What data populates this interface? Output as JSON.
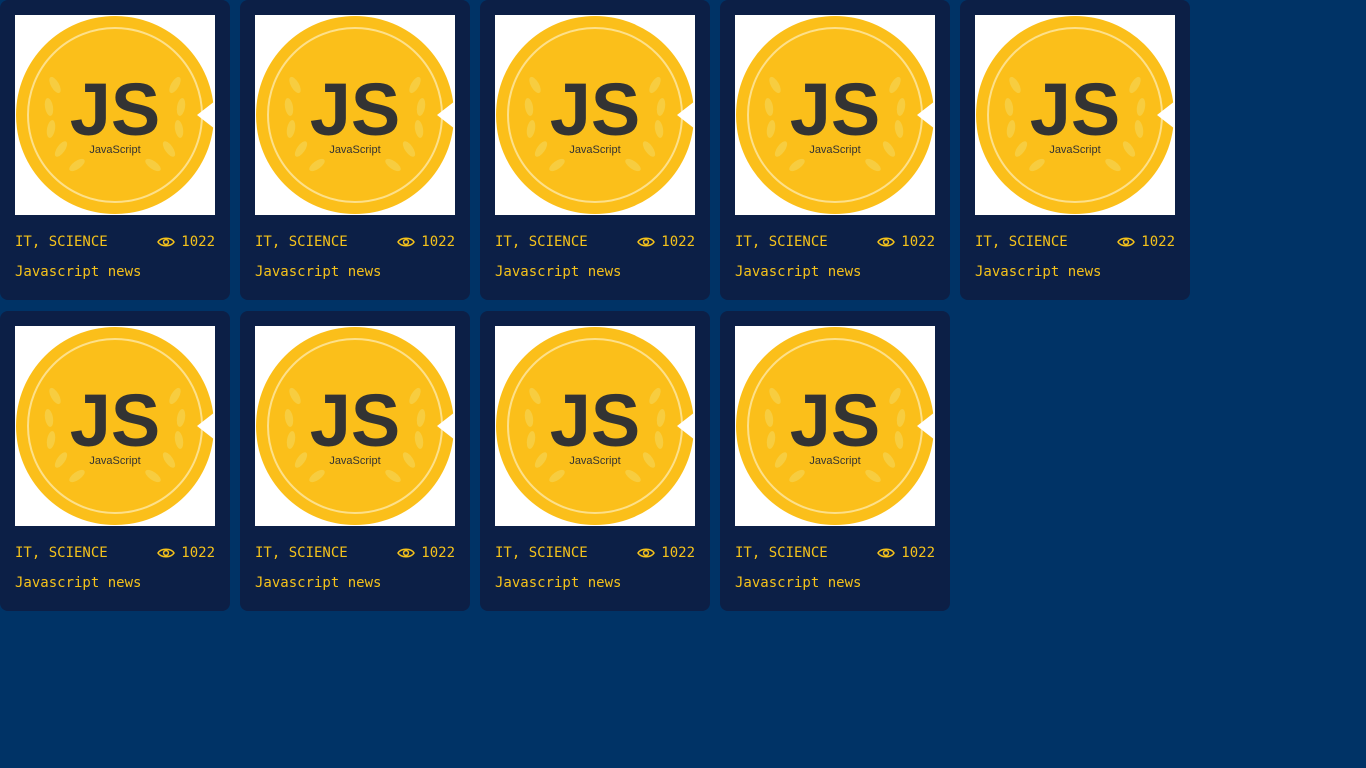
{
  "colors": {
    "page_background": "#003366",
    "card_background": "#0c1f46",
    "accent": "#f5c21b",
    "badge_gold": "#fbbf1a",
    "badge_text": "#333333"
  },
  "cards": [
    {
      "image": {
        "logo_text": "JS",
        "logo_caption": "JavaScript"
      },
      "category": "IT, SCIENCE",
      "views": "1022",
      "title": "Javascript news",
      "eye_icon": "eye-icon"
    },
    {
      "image": {
        "logo_text": "JS",
        "logo_caption": "JavaScript"
      },
      "category": "IT, SCIENCE",
      "views": "1022",
      "title": "Javascript news",
      "eye_icon": "eye-icon"
    },
    {
      "image": {
        "logo_text": "JS",
        "logo_caption": "JavaScript"
      },
      "category": "IT, SCIENCE",
      "views": "1022",
      "title": "Javascript news",
      "eye_icon": "eye-icon"
    },
    {
      "image": {
        "logo_text": "JS",
        "logo_caption": "JavaScript"
      },
      "category": "IT, SCIENCE",
      "views": "1022",
      "title": "Javascript news",
      "eye_icon": "eye-icon"
    },
    {
      "image": {
        "logo_text": "JS",
        "logo_caption": "JavaScript"
      },
      "category": "IT, SCIENCE",
      "views": "1022",
      "title": "Javascript news",
      "eye_icon": "eye-icon"
    },
    {
      "image": {
        "logo_text": "JS",
        "logo_caption": "JavaScript"
      },
      "category": "IT, SCIENCE",
      "views": "1022",
      "title": "Javascript news",
      "eye_icon": "eye-icon"
    },
    {
      "image": {
        "logo_text": "JS",
        "logo_caption": "JavaScript"
      },
      "category": "IT, SCIENCE",
      "views": "1022",
      "title": "Javascript news",
      "eye_icon": "eye-icon"
    },
    {
      "image": {
        "logo_text": "JS",
        "logo_caption": "JavaScript"
      },
      "category": "IT, SCIENCE",
      "views": "1022",
      "title": "Javascript news",
      "eye_icon": "eye-icon"
    },
    {
      "image": {
        "logo_text": "JS",
        "logo_caption": "JavaScript"
      },
      "category": "IT, SCIENCE",
      "views": "1022",
      "title": "Javascript news",
      "eye_icon": "eye-icon"
    }
  ]
}
